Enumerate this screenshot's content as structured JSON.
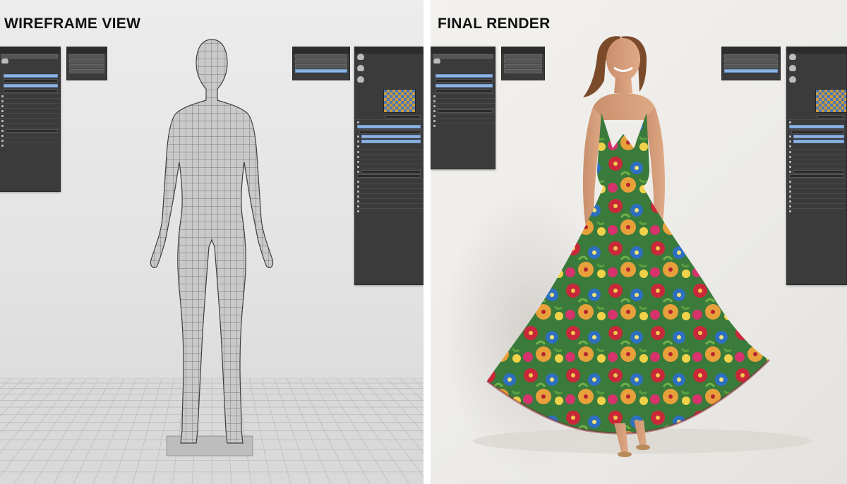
{
  "left": {
    "title": "WIREFRAME VIEW"
  },
  "right": {
    "title": "FINAL RENDER"
  },
  "colors": {
    "panel_bg": "#3b3b3b",
    "panel_header": "#2c2c2c",
    "accent_blue": "#8fb4e2",
    "wire": "#555555"
  }
}
